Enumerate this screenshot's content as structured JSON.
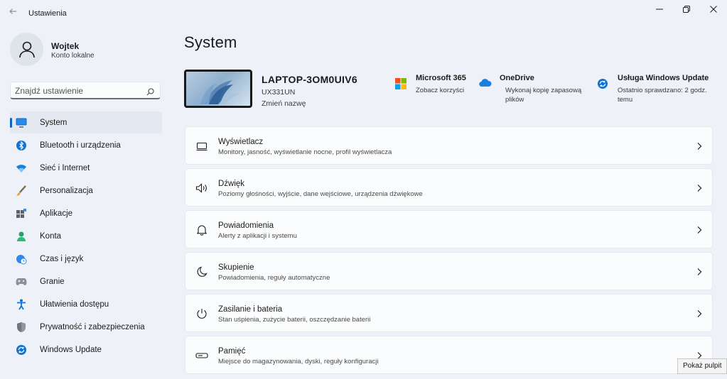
{
  "window": {
    "title": "Ustawienia"
  },
  "profile": {
    "name": "Wojtek",
    "account_type": "Konto lokalne"
  },
  "search": {
    "placeholder": "Znajdź ustawienie"
  },
  "sidebar": {
    "items": [
      {
        "label": "System",
        "icon": "monitor-icon",
        "active": true
      },
      {
        "label": "Bluetooth i urządzenia",
        "icon": "bluetooth-icon"
      },
      {
        "label": "Sieć i Internet",
        "icon": "wifi-icon"
      },
      {
        "label": "Personalizacja",
        "icon": "brush-icon"
      },
      {
        "label": "Aplikacje",
        "icon": "apps-icon"
      },
      {
        "label": "Konta",
        "icon": "person-icon"
      },
      {
        "label": "Czas i język",
        "icon": "globe-clock-icon"
      },
      {
        "label": "Granie",
        "icon": "gamepad-icon"
      },
      {
        "label": "Ułatwienia dostępu",
        "icon": "accessibility-icon"
      },
      {
        "label": "Prywatność i zabezpieczenia",
        "icon": "shield-icon"
      },
      {
        "label": "Windows Update",
        "icon": "update-icon"
      }
    ]
  },
  "main": {
    "title": "System",
    "device": {
      "name": "LAPTOP-3OM0UIV6",
      "model": "UX331UN",
      "rename_link": "Zmień nazwę"
    },
    "services": [
      {
        "title": "Microsoft 365",
        "subtitle": "Zobacz korzyści",
        "icon": "microsoft-logo-icon"
      },
      {
        "title": "OneDrive",
        "subtitle": "Wykonaj kopię zapasową plików",
        "icon": "cloud-icon"
      },
      {
        "title": "Usługa Windows Update",
        "subtitle": "Ostatnio sprawdzano: 2 godz. temu",
        "icon": "update-icon"
      }
    ],
    "cards": [
      {
        "title": "Wyświetlacz",
        "subtitle": "Monitory, jasność, wyświetlanie nocne, profil wyświetlacza",
        "icon": "display-icon"
      },
      {
        "title": "Dźwięk",
        "subtitle": "Poziomy głośności, wyjście, dane wejściowe, urządzenia dźwiękowe",
        "icon": "speaker-icon"
      },
      {
        "title": "Powiadomienia",
        "subtitle": "Alerty z aplikacji i systemu",
        "icon": "bell-icon"
      },
      {
        "title": "Skupienie",
        "subtitle": "Powiadomienia, reguły automatyczne",
        "icon": "moon-icon"
      },
      {
        "title": "Zasilanie i bateria",
        "subtitle": "Stan uśpienia, zużycie baterii, oszczędzanie baterii",
        "icon": "power-icon"
      },
      {
        "title": "Pamięć",
        "subtitle": "Miejsce do magazynowania, dyski, reguły konfiguracji",
        "icon": "storage-icon"
      }
    ]
  },
  "tooltip": {
    "text": "Pokaż pulpit"
  },
  "colors": {
    "accent": "#0a64c8",
    "background": "#eef2f8",
    "card": "#fbfcfd"
  }
}
